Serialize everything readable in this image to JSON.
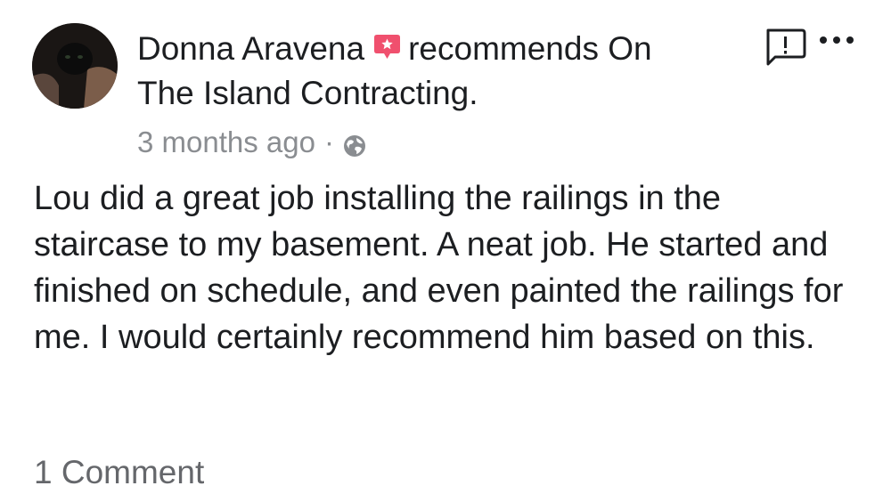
{
  "post": {
    "author": "Donna Aravena",
    "action_text": "recommends On",
    "page_name_continued": "The Island Contracting.",
    "timestamp": "3 months ago",
    "separator": "·",
    "privacy_icon": "globe-icon",
    "recommend_icon": "recommend-star-icon",
    "body": "Lou did a great job installing the railings in the staircase to my basement. A neat job. He started and finished on schedule, and even painted the railings for me. I would certainly recommend him based on this.",
    "comment_count": "1 Comment"
  },
  "actions": {
    "report_icon": "report-icon",
    "more_icon": "more-options-icon"
  },
  "colors": {
    "text": "#1c1e21",
    "secondary": "#8a8d91",
    "recommend_badge": "#f0506e"
  }
}
